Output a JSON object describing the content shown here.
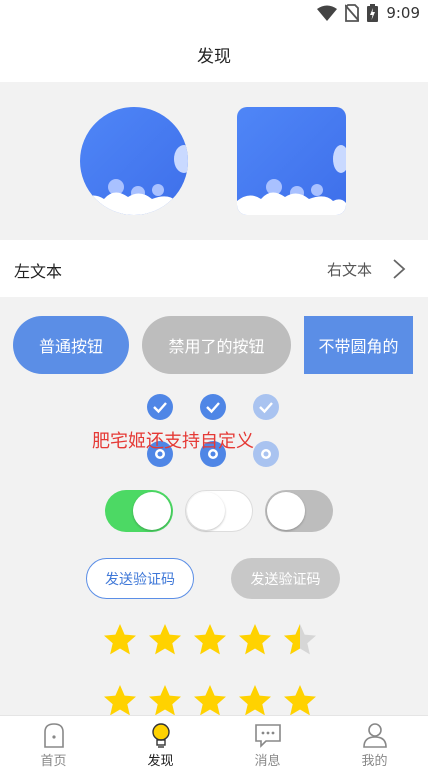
{
  "status_bar": {
    "time": "9:09",
    "icons": [
      "wifi-icon",
      "no-sim-icon",
      "battery-charging-icon"
    ]
  },
  "header": {
    "title": "发现"
  },
  "images": {
    "circle": "avatar-circle-image",
    "rounded": "avatar-rounded-image"
  },
  "list_row": {
    "left": "左文本",
    "right": "右文本",
    "arrow": "chevron-right-icon"
  },
  "buttons": {
    "normal": "普通按钮",
    "disabled": "禁用了的按钮",
    "square": "不带圆角的"
  },
  "checkboxes": [
    {
      "checked": true,
      "disabled": false
    },
    {
      "checked": true,
      "disabled": false
    },
    {
      "checked": true,
      "disabled": true
    }
  ],
  "radios": [
    {
      "selected": true,
      "disabled": false
    },
    {
      "selected": true,
      "disabled": false
    },
    {
      "selected": true,
      "disabled": true
    }
  ],
  "overlay_text": "肥宅姬还支持自定义",
  "switches": [
    {
      "on": true
    },
    {
      "on": false
    },
    {
      "on": false,
      "disabled": true
    }
  ],
  "code_buttons": {
    "active": "发送验证码",
    "disabled": "发送验证码"
  },
  "ratings": [
    {
      "value": 4.5,
      "max": 5
    },
    {
      "value": 5,
      "max": 5
    }
  ],
  "colors": {
    "primary": "#5b8ee6",
    "disabled": "#bdbdbd",
    "switch_on": "#4cd964",
    "star": "#ffd200",
    "accent_text": "#e53935"
  },
  "tabbar": {
    "items": [
      {
        "label": "首页",
        "icon": "home-icon",
        "active": false
      },
      {
        "label": "发现",
        "icon": "bulb-icon",
        "active": true
      },
      {
        "label": "消息",
        "icon": "message-icon",
        "active": false
      },
      {
        "label": "我的",
        "icon": "user-icon",
        "active": false
      }
    ]
  }
}
